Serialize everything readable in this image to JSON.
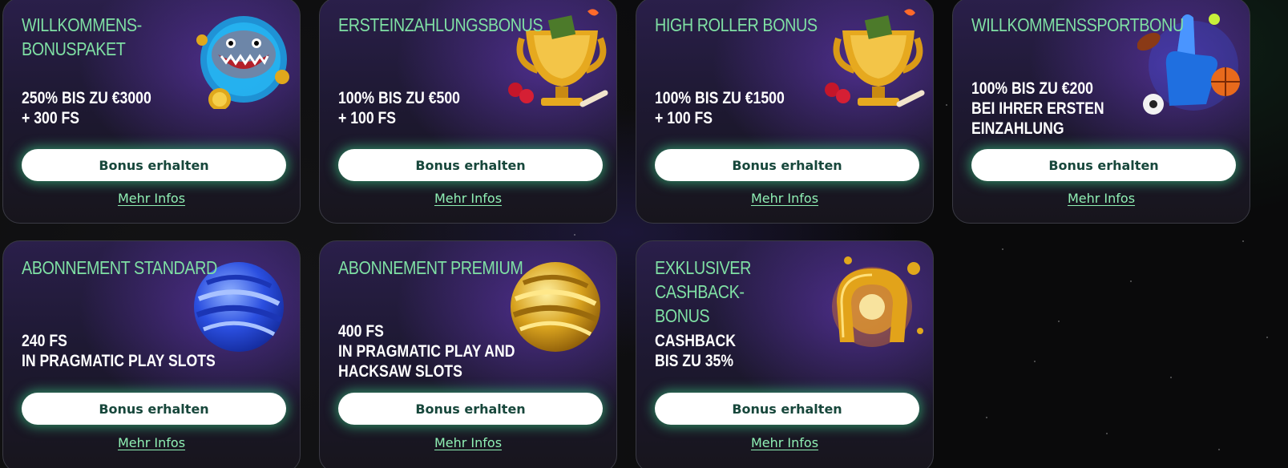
{
  "cards": [
    {
      "title": "WILLKOMMENS-BONUSPAKET",
      "offer": [
        "250% BIS ZU €3000",
        "+ 300 FS"
      ],
      "button": "Bonus erhalten",
      "more": "Mehr Infos",
      "icon": "shark-icon"
    },
    {
      "title": "ERSTEINZAHLUNGSBONUS",
      "offer": [
        "100% BIS ZU €500",
        "+ 100 FS"
      ],
      "button": "Bonus erhalten",
      "more": "Mehr Infos",
      "icon": "golden-trophy-icon"
    },
    {
      "title": "HIGH ROLLER BONUS",
      "offer": [
        "100% BIS ZU €1500",
        "+ 100 FS"
      ],
      "button": "Bonus erhalten",
      "more": "Mehr Infos",
      "icon": "golden-trophy-icon"
    },
    {
      "title": "WILLKOMMENSSPORTBONU",
      "offer": [
        "100% BIS ZU €200",
        "BEI IHRER ERSTEN",
        "EINZAHLUNG"
      ],
      "button": "Bonus erhalten",
      "more": "Mehr Infos",
      "icon": "foam-finger-sports-icon"
    },
    {
      "title": "ABONNEMENT STANDARD",
      "offer": [
        "240 FS",
        "IN PRAGMATIC PLAY SLOTS"
      ],
      "button": "Bonus erhalten",
      "more": "Mehr Infos",
      "icon": "blue-twisted-sphere-icon"
    },
    {
      "title": "ABONNEMENT PREMIUM",
      "offer": [
        "400 FS",
        "IN PRAGMATIC PLAY AND",
        "HACKSAW SLOTS"
      ],
      "button": "Bonus erhalten",
      "more": "Mehr Infos",
      "icon": "gold-twisted-sphere-icon"
    },
    {
      "title": "EXKLUSIVER CASHBACK-BONUS",
      "offer": [
        "CASHBACK",
        "BIS ZU 35%"
      ],
      "button": "Bonus erhalten",
      "more": "Mehr Infos",
      "icon": "golden-horseshoe-icon"
    }
  ],
  "colors": {
    "title": "#7fe0a4",
    "offer": "#ffffff",
    "button_bg": "#ffffff",
    "button_text": "#17473b",
    "link": "#8ff0b4",
    "glow": "#3cdc8c"
  }
}
